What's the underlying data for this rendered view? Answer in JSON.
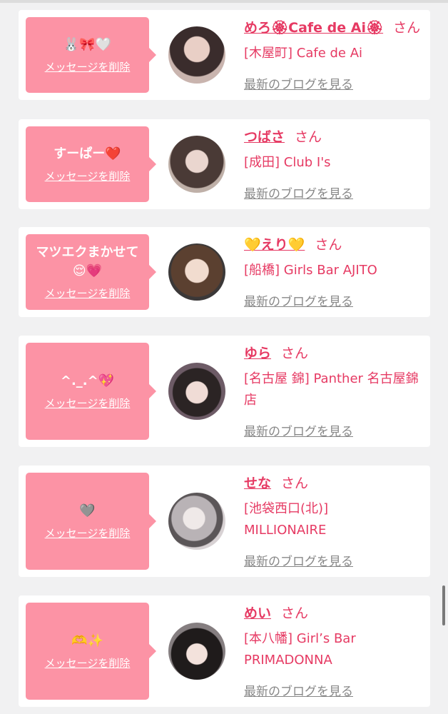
{
  "entries": [
    {
      "message": "🐰🎀🤍",
      "delete_label": "メッセージを削除",
      "name": "めろ🏵Cafe de Ai🏵",
      "honorific": "さん",
      "shop": "[木屋町] Cafe de Ai",
      "blog_label": "最新のブログを見る"
    },
    {
      "message": "すーぱー❤️",
      "delete_label": "メッセージを削除",
      "name": "つばさ",
      "honorific": "さん",
      "shop": "[成田] Club I's",
      "blog_label": "最新のブログを見る"
    },
    {
      "message": "マツエクまかせて😌💗",
      "delete_label": "メッセージを削除",
      "name": "💛えり💛",
      "honorific": "さん",
      "shop": "[船橋] Girls Bar AJITO",
      "blog_label": "最新のブログを見る"
    },
    {
      "message": "^._.^💖",
      "delete_label": "メッセージを削除",
      "name": "ゆら",
      "honorific": "さん",
      "shop": "[名古屋 錦] Panther 名古屋錦店",
      "blog_label": "最新のブログを見る"
    },
    {
      "message": "🩶",
      "delete_label": "メッセージを削除",
      "name": "せな",
      "honorific": "さん",
      "shop": "[池袋西口(北)] MILLIONAIRE",
      "blog_label": "最新のブログを見る"
    },
    {
      "message": "🫶✨",
      "delete_label": "メッセージを削除",
      "name": "めい",
      "honorific": "さん",
      "shop": "[本八幡] Girl’s Bar PRIMADONNA",
      "blog_label": "最新のブログを見る"
    }
  ],
  "colors": {
    "accent": "#e63a63",
    "bubble": "#fc93a5",
    "link_gray": "#888888",
    "page_bg": "#f1f1f2"
  }
}
